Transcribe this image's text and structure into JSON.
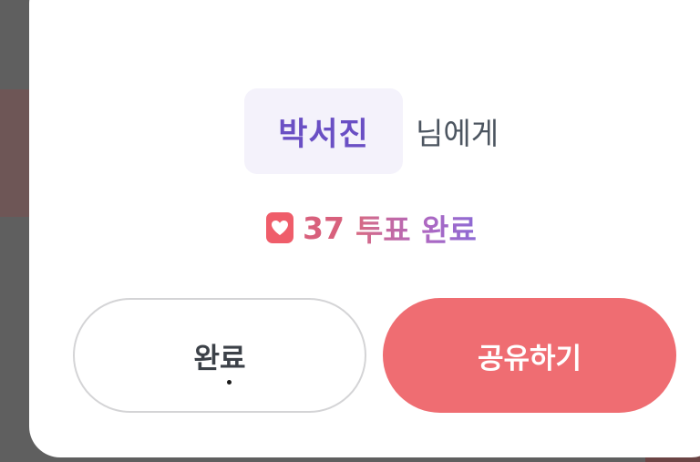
{
  "modal": {
    "recipient_name": "박서진",
    "recipient_suffix": "님에게",
    "vote_count": "37",
    "vote_label": "투표 완료",
    "done_button_label": "완료",
    "share_button_label": "공유하기"
  },
  "colors": {
    "name_chip_bg": "#f4f2fb",
    "name_text": "#6a4fc4",
    "heart_badge": "#ef5d6a",
    "share_button_bg": "#ef6d72",
    "done_button_border": "#d4d4d6"
  },
  "icons": {
    "vote_badge": "heart-icon"
  }
}
